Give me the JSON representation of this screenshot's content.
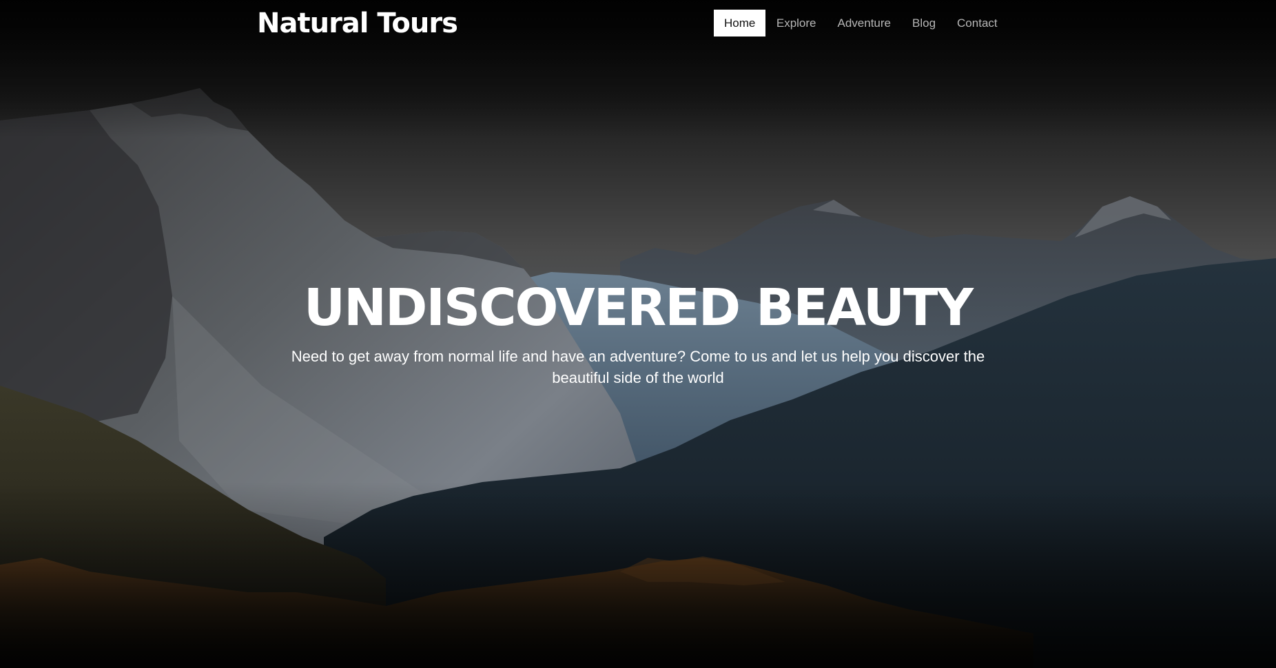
{
  "brand": {
    "name": "Natural Tours"
  },
  "nav": {
    "items": [
      {
        "label": "Home",
        "active": true
      },
      {
        "label": "Explore",
        "active": false
      },
      {
        "label": "Adventure",
        "active": false
      },
      {
        "label": "Blog",
        "active": false
      },
      {
        "label": "Contact",
        "active": false
      }
    ]
  },
  "hero": {
    "title": "UNDISCOVERED BEAUTY",
    "subtitle": "Need to get away from normal life and have an adventure? Come to us and let us help you discover the beautiful side of the world"
  },
  "colors": {
    "nav_active_bg": "#ffffff",
    "nav_active_text": "#111111",
    "nav_text": "#b7b7b7",
    "title_text": "#ffffff"
  }
}
